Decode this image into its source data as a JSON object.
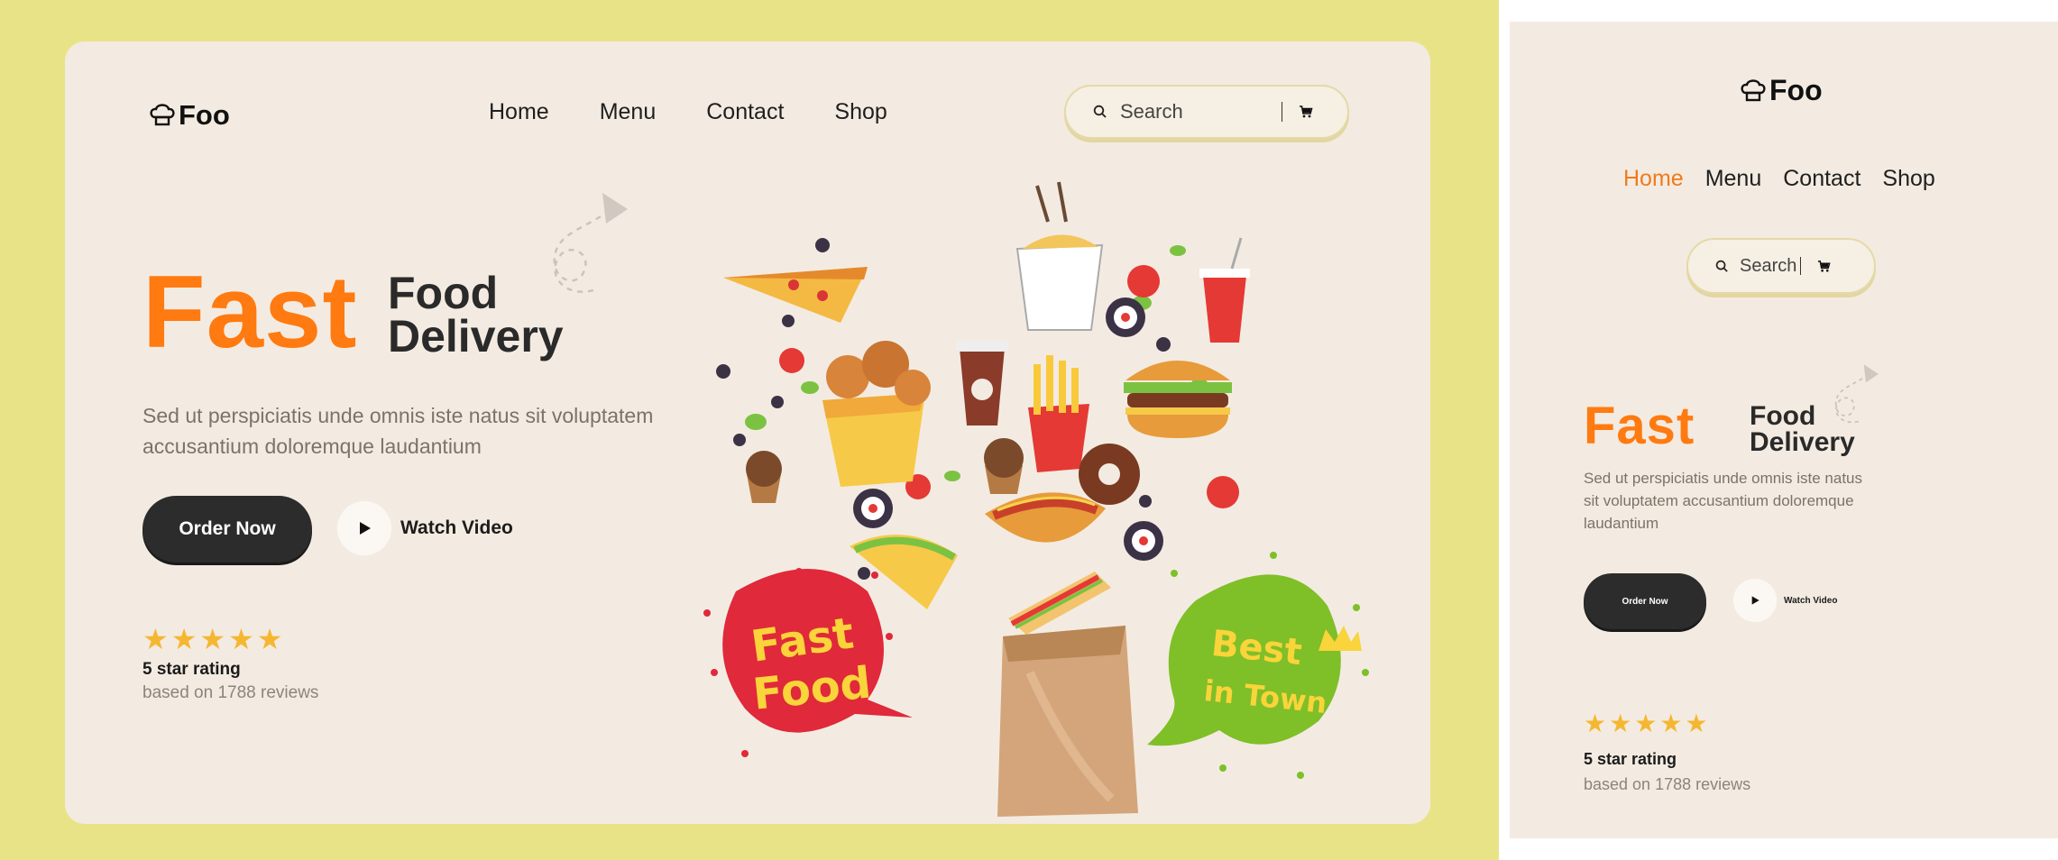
{
  "brand": {
    "name": "Foo"
  },
  "nav": {
    "items": [
      "Home",
      "Menu",
      "Contact",
      "Shop"
    ],
    "active": "Home"
  },
  "search": {
    "placeholder": "Search"
  },
  "hero": {
    "title_big": "Fast",
    "title_line1": "Food",
    "title_line2": "Delivery",
    "description": "Sed ut perspiciatis unde omnis iste natus sit voluptatem accusantium doloremque laudantium",
    "order_button": "Order Now",
    "watch_button": "Watch Video"
  },
  "rating": {
    "stars": "★★★★★",
    "title": "5 star rating",
    "subtitle": "based on 1788 reviews"
  },
  "illustration": {
    "left_bubble": "Fast Food",
    "right_bubble_line1": "Best",
    "right_bubble_line2": "in Town"
  },
  "colors": {
    "accent": "#ff7a10",
    "dark": "#2c2c2c",
    "card": "#f3ebe1",
    "frame": "#e9e388",
    "star": "#f5b731"
  }
}
